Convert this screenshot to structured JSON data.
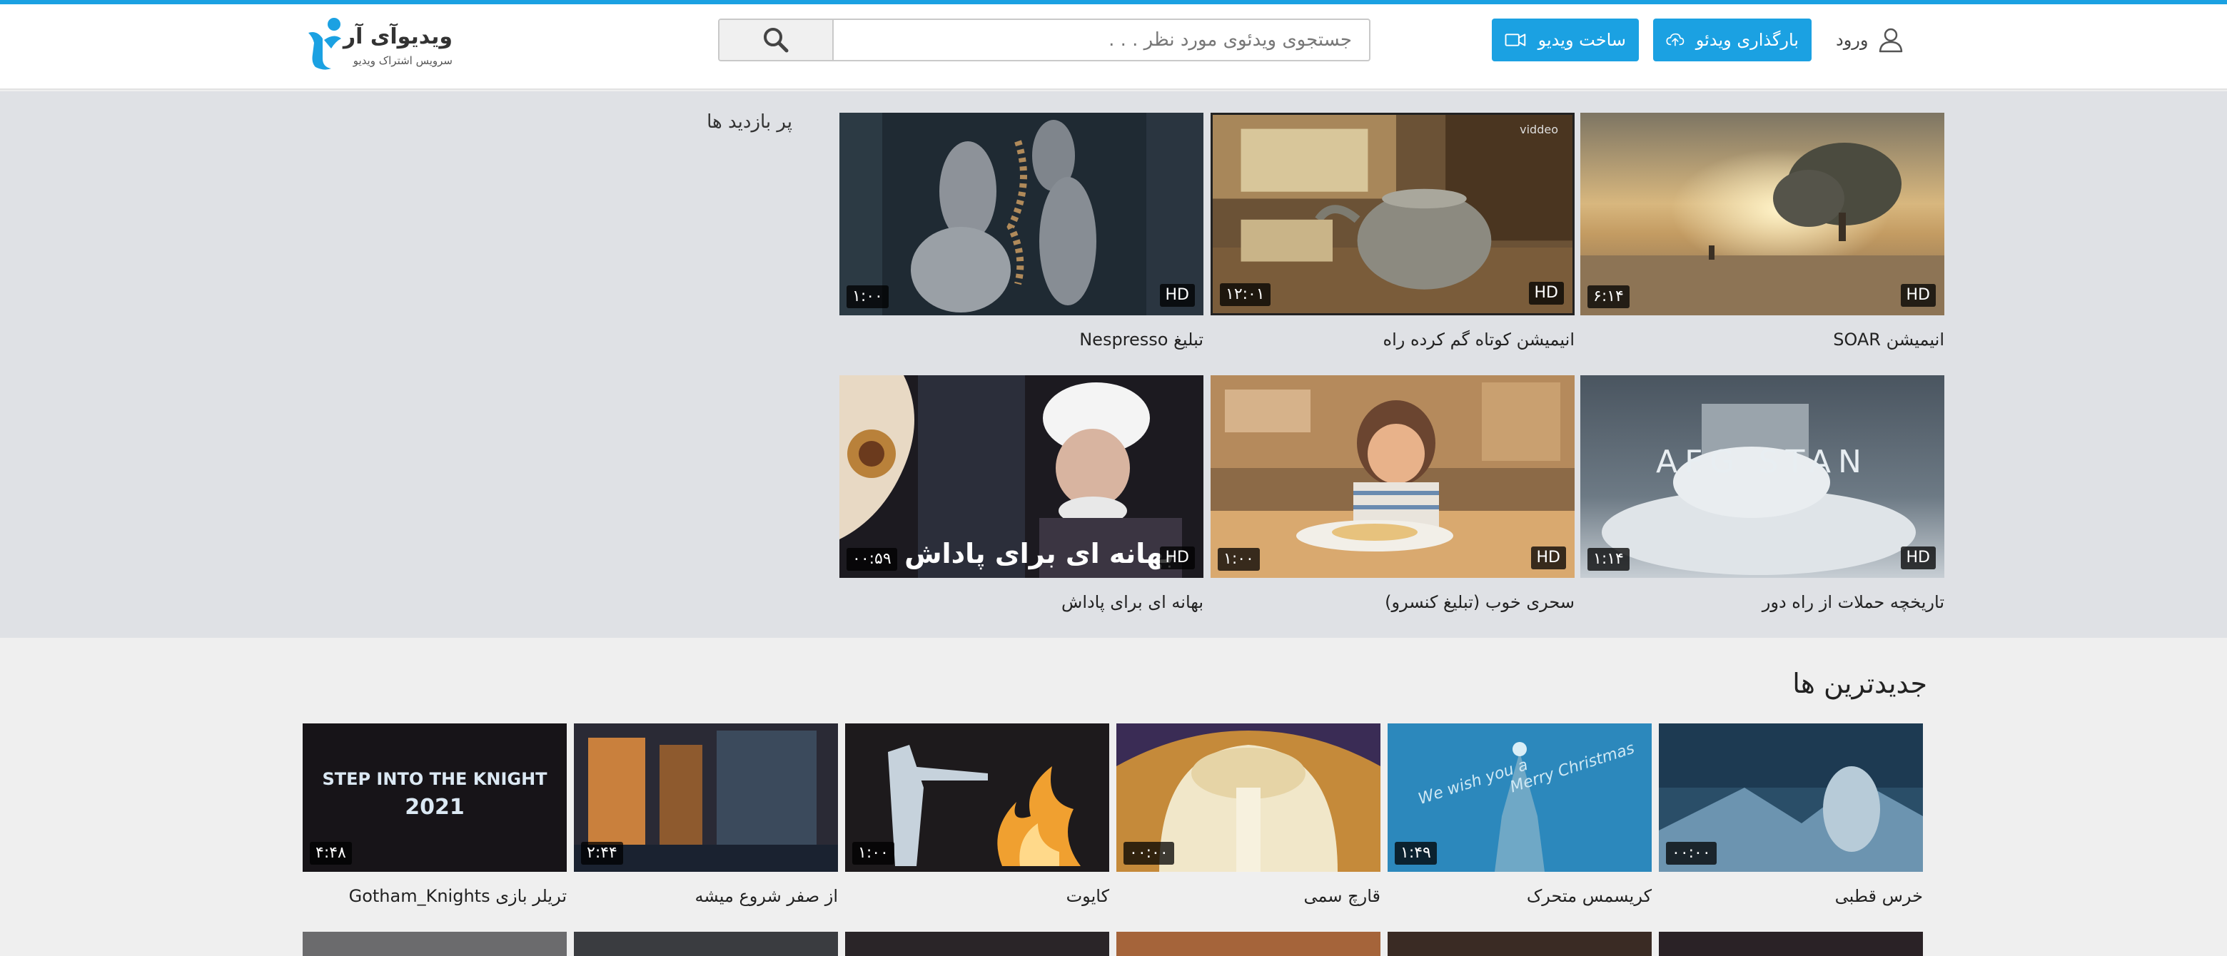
{
  "header": {
    "logo_title": "ویدیوآی آر",
    "logo_subtitle": "سرویس اشتراک ویدیو",
    "search_placeholder": "جستجوی ویدئوی مورد نظر . . .",
    "make_video_label": "ساخت ویدیو",
    "upload_label": "بارگذاری ویدئو",
    "login_label": "ورود"
  },
  "popular": {
    "title": "پر بازدید ها",
    "videos": [
      {
        "title": "انیمیشن SOAR",
        "duration": "۶:۱۴",
        "hd": "HD"
      },
      {
        "title": "انیمیشن کوتاه گم کرده راه",
        "duration": "۱۲:۰۱",
        "hd": "HD"
      },
      {
        "title": "تبلیغ Nespresso",
        "duration": "۱:۰۰",
        "hd": "HD"
      },
      {
        "title": "تاریخچه حملات از راه دور",
        "duration": "۱:۱۴",
        "hd": "HD"
      },
      {
        "title": "سحری خوب (تبلیغ کنسرو)",
        "duration": "۱:۰۰",
        "hd": "HD"
      },
      {
        "title": "بهانه ای برای پاداش",
        "duration": "۰۰:۵۹",
        "hd": "HD"
      }
    ],
    "thumb_texts": {
      "afghanistan": "AFG    STAN",
      "reward_caption": "بهانه ای برای پاداش",
      "vidoe_mark": "viddeo"
    }
  },
  "newest": {
    "title": "جدیدترین ها",
    "videos": [
      {
        "title": "خرس قطبی",
        "duration": "۰۰:۰۰"
      },
      {
        "title": "کریسمس متحرک",
        "duration": "۱:۴۹"
      },
      {
        "title": "قارچ سمی",
        "duration": "۰۰:۰۰"
      },
      {
        "title": "کایوت",
        "duration": "۱:۰۰"
      },
      {
        "title": "از صفر شروع میشه",
        "duration": "۲:۴۴"
      },
      {
        "title": "تریلر بازی Gotham_Knights",
        "duration": "۴:۴۸"
      }
    ],
    "thumb_texts": {
      "knight_line1": "STEP INTO THE KNIGHT",
      "knight_line2": "2021",
      "xmas_left": "We wish you a",
      "xmas_right": "Merry Christmas"
    }
  },
  "colors": {
    "accent": "#1ba1e2",
    "popular_bg": "#dfe1e5",
    "page_bg": "#efefef"
  }
}
